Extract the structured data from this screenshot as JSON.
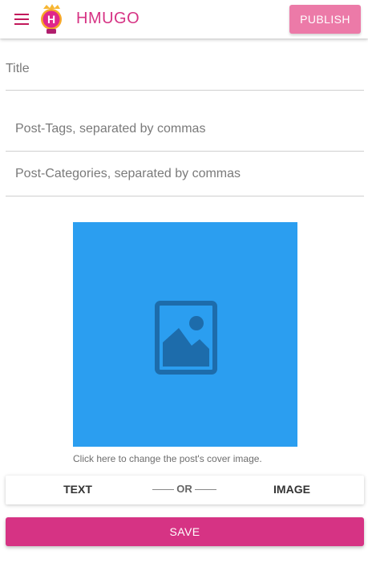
{
  "appbar": {
    "brand": "HMUGO",
    "logo_letter": "H",
    "publish_label": "PUBLISH"
  },
  "form": {
    "title_placeholder": "Title",
    "tags_placeholder": "Post-Tags, separated by commas",
    "categories_placeholder": "Post-Categories, separated by commas"
  },
  "cover": {
    "icon": "image-placeholder-icon",
    "caption": "Click here to change the post's cover image."
  },
  "mode_toggle": {
    "text_label": "TEXT",
    "separator_label": "OR",
    "image_label": "IMAGE"
  },
  "save_label": "SAVE",
  "colors": {
    "accent": "#d63384",
    "publish_bg": "#ec7aa8",
    "cover_bg": "#2b9ef0",
    "cover_icon": "#1d6cab"
  }
}
